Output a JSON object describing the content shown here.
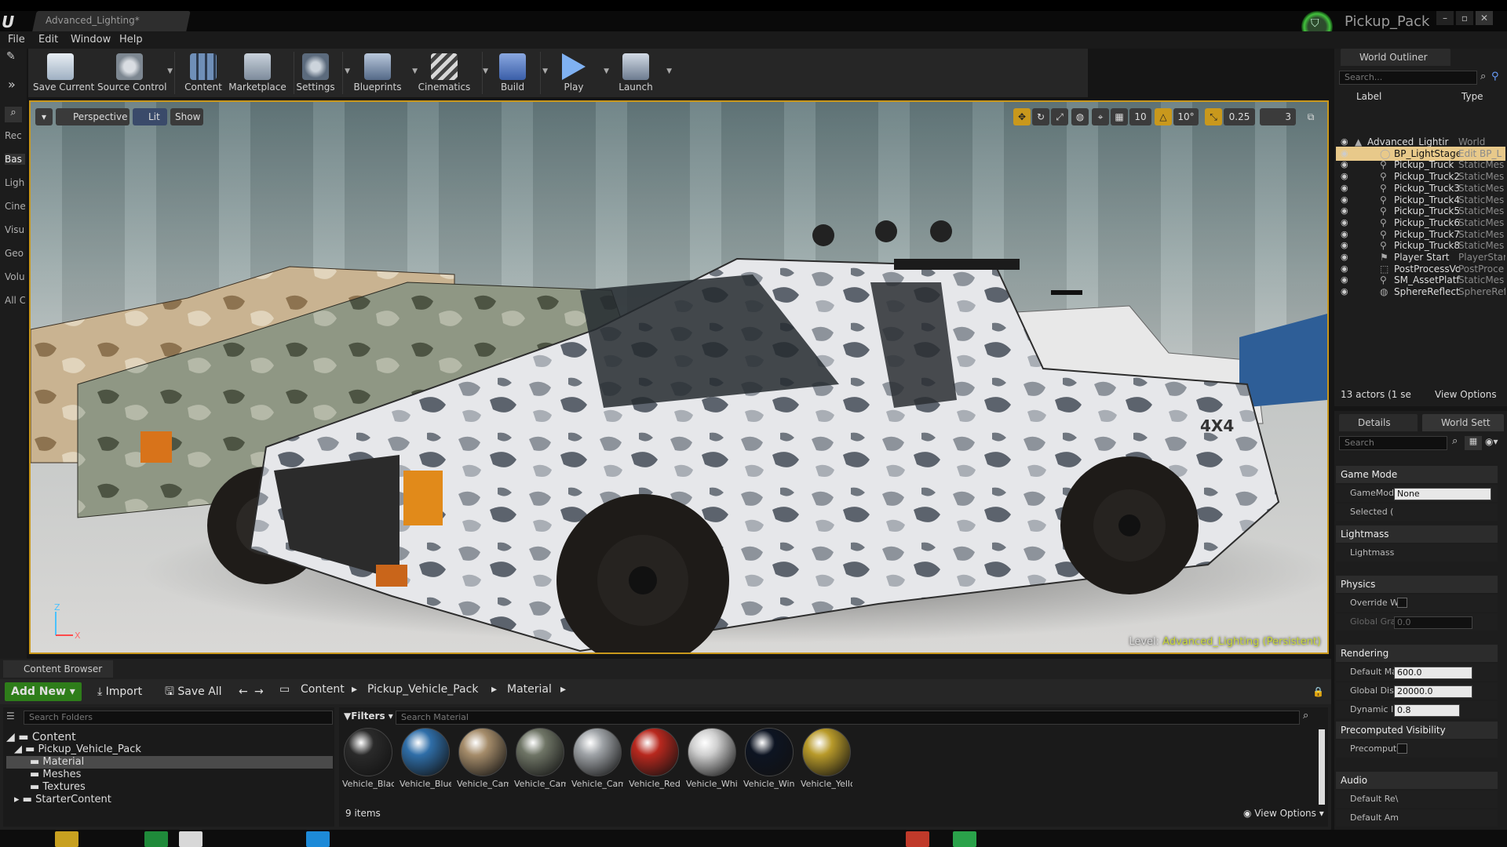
{
  "titlebar": {
    "document_tab": "Advanced_Lighting*",
    "project_name": "Pickup_Pack",
    "window_buttons": [
      "–",
      "▫",
      "✕"
    ]
  },
  "menu": {
    "items": [
      "File",
      "Edit",
      "Window",
      "Help"
    ]
  },
  "modes": {
    "items": [
      "Rec",
      "Bas",
      "Ligh",
      "Cine",
      "Visu",
      "Geo",
      "Volu",
      "All C"
    ]
  },
  "toolbar": {
    "buttons": [
      {
        "label": "Save Current",
        "icon": "save-icon"
      },
      {
        "label": "Source Control",
        "icon": "source-control-icon"
      },
      {
        "label": "Content",
        "icon": "content-icon"
      },
      {
        "label": "Marketplace",
        "icon": "marketplace-icon"
      },
      {
        "label": "Settings",
        "icon": "settings-icon"
      },
      {
        "label": "Blueprints",
        "icon": "blueprints-icon"
      },
      {
        "label": "Cinematics",
        "icon": "cinematics-icon"
      },
      {
        "label": "Build",
        "icon": "build-icon"
      },
      {
        "label": "Play",
        "icon": "play-icon"
      },
      {
        "label": "Launch",
        "icon": "launch-icon"
      }
    ]
  },
  "viewport": {
    "perspective": "Perspective",
    "lit": "Lit",
    "show": "Show",
    "grid_snap": "10",
    "rotation_snap": "10°",
    "scale_snap": "0.25",
    "camera_speed": "3",
    "level_prefix": "Level:",
    "level_name": "Advanced_Lighting (Persistent)",
    "axis_z": "Z",
    "axis_x": "X",
    "vehicle_decal": "4X4"
  },
  "outliner": {
    "tab": "World Outliner",
    "search_placeholder": "Search...",
    "col_label": "Label",
    "col_type": "Type",
    "rows": [
      {
        "label": "Advanced_Lightir",
        "type": "World"
      },
      {
        "label": "BP_LightStage",
        "type": "Edit BP_L"
      },
      {
        "label": "Pickup_Truck",
        "type": "StaticMes"
      },
      {
        "label": "Pickup_Truck2",
        "type": "StaticMes"
      },
      {
        "label": "Pickup_Truck3",
        "type": "StaticMes"
      },
      {
        "label": "Pickup_Truck4",
        "type": "StaticMes"
      },
      {
        "label": "Pickup_Truck5",
        "type": "StaticMes"
      },
      {
        "label": "Pickup_Truck6",
        "type": "StaticMes"
      },
      {
        "label": "Pickup_Truck7",
        "type": "StaticMes"
      },
      {
        "label": "Pickup_Truck8",
        "type": "StaticMes"
      },
      {
        "label": "Player Start",
        "type": "PlayerStar"
      },
      {
        "label": "PostProcessVo",
        "type": "PostProce"
      },
      {
        "label": "SM_AssetPlatfc",
        "type": "StaticMes"
      },
      {
        "label": "SphereReflectic",
        "type": "SphereRef"
      }
    ],
    "footer_count": "13 actors (1 se",
    "view_options": "View Options"
  },
  "details": {
    "tab_details": "Details",
    "tab_world": "World Sett",
    "search_placeholder": "Search",
    "categories": {
      "game_mode": "Game Mode",
      "lightmass": "Lightmass",
      "physics": "Physics",
      "rendering": "Rendering",
      "precomputed": "Precomputed Visibility",
      "audio": "Audio"
    },
    "props": {
      "gamemode": "GameMod",
      "gamemode_value": "None",
      "selected": "Selected (",
      "lightmass": "Lightmass",
      "override": "Override W",
      "global_grav": "Global Grav",
      "global_grav_value": "0.0",
      "default_max": "Default Ma",
      "default_max_value": "600.0",
      "global_dist": "Global Dist",
      "global_dist_value": "20000.0",
      "dynamic": "Dynamic Ir",
      "dynamic_value": "0.8",
      "precomput": "Precomput",
      "default_rev": "Default Re\\",
      "default_amb": "Default Am"
    }
  },
  "content_browser": {
    "tab": "Content Browser",
    "add_new": "Add New",
    "import": "Import",
    "save_all": "Save All",
    "breadcrumb": [
      "Content",
      "Pickup_Vehicle_Pack",
      "Material"
    ],
    "folder_search_placeholder": "Search Folders",
    "filters": "Filters",
    "asset_search_placeholder": "Search Material",
    "tree": [
      "Content",
      "Pickup_Vehicle_Pack",
      "Material",
      "Meshes",
      "Textures",
      "StarterContent"
    ],
    "assets": [
      {
        "name": "Vehicle_Black",
        "color": "#2a2a2a"
      },
      {
        "name": "Vehicle_Blue",
        "color": "#2f6ea8"
      },
      {
        "name": "Vehicle_Camouflage_",
        "color": "#a58c6a"
      },
      {
        "name": "Vehicle_Camouflage_",
        "color": "#6f7566"
      },
      {
        "name": "Vehicle_Camouflage_",
        "color": "#9ea2a6"
      },
      {
        "name": "Vehicle_Red",
        "color": "#b8281e"
      },
      {
        "name": "Vehicle_White",
        "color": "#cfcfcf"
      },
      {
        "name": "Vehicle_Windows",
        "color": "#0d1422"
      },
      {
        "name": "Vehicle_Yellow",
        "color": "#b89a2a"
      }
    ],
    "item_count": "9 items",
    "view_options": "View Options"
  },
  "colors": {
    "accent": "#c9981c",
    "add_new_green": "#2e7d1a",
    "level_name": "#c9d83a"
  }
}
